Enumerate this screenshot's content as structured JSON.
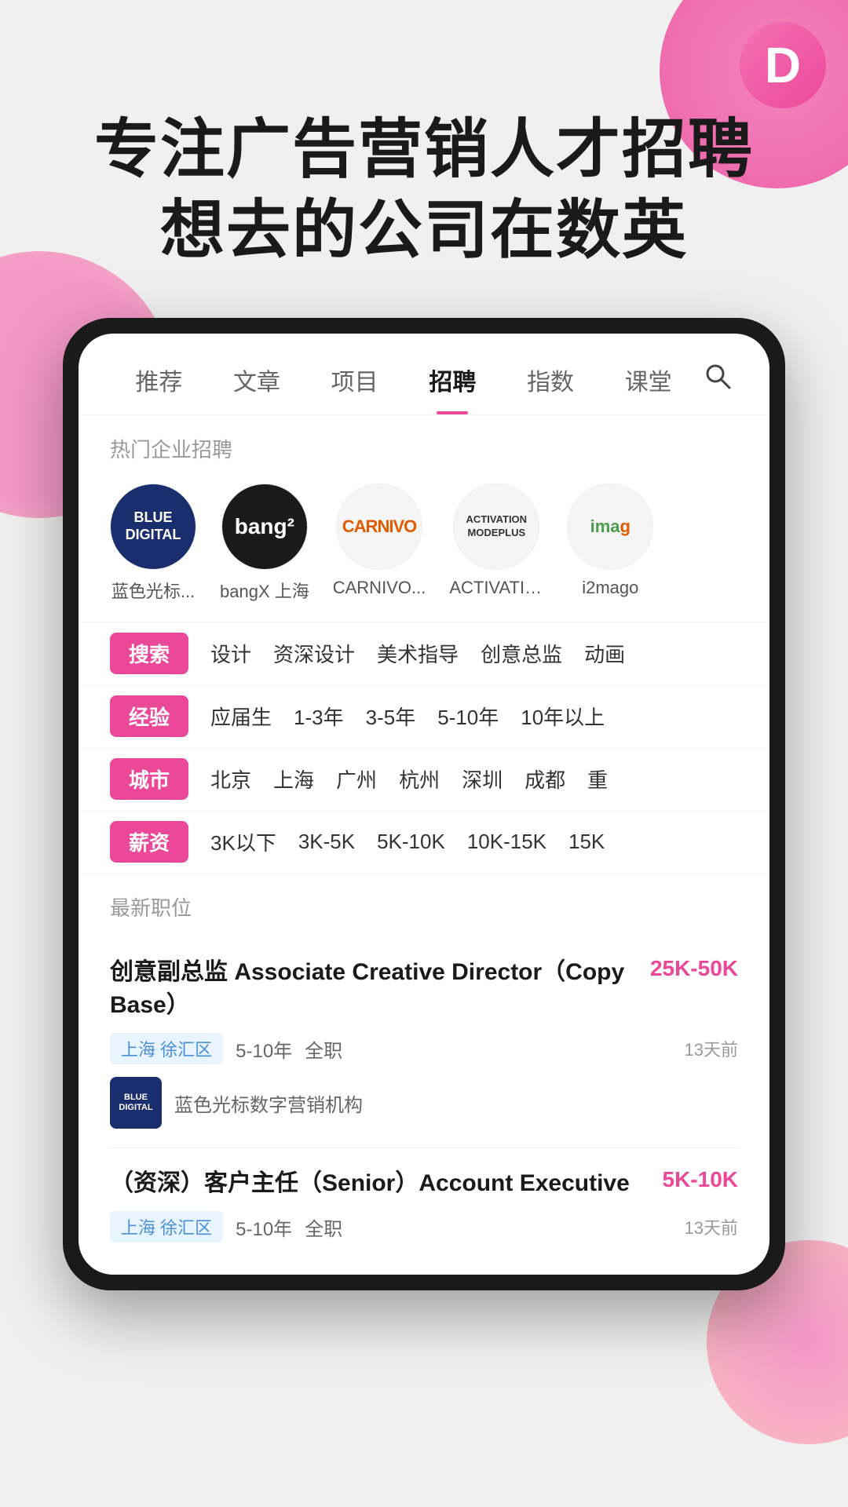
{
  "app": {
    "logo_letter": "D",
    "hero_line1": "专注广告营销人才招聘",
    "hero_line2": "想去的公司在数英"
  },
  "navbar": {
    "items": [
      {
        "label": "推荐",
        "active": false
      },
      {
        "label": "文章",
        "active": false
      },
      {
        "label": "项目",
        "active": false
      },
      {
        "label": "招聘",
        "active": true
      },
      {
        "label": "指数",
        "active": false
      },
      {
        "label": "课堂",
        "active": false
      }
    ],
    "search_icon": "search"
  },
  "hot_companies": {
    "label": "热门企业招聘",
    "items": [
      {
        "name": "蓝色光标...",
        "logo_type": "blue-digital",
        "logo_text": "BLUE\nDIGITAL"
      },
      {
        "name": "bangX 上海",
        "logo_type": "bangx",
        "logo_text": "bang²"
      },
      {
        "name": "CARNIVO...",
        "logo_type": "carnivo",
        "logo_text": "CARNIVO"
      },
      {
        "name": "ACTIVATIO...",
        "logo_type": "activation",
        "logo_text": "ACTIVATION\nMODEPLUS"
      },
      {
        "name": "i2mago",
        "logo_type": "i2mago",
        "logo_text": "ima"
      }
    ]
  },
  "filters": [
    {
      "badge": "搜索",
      "tags": [
        "设计",
        "资深设计",
        "美术指导",
        "创意总监",
        "动画"
      ]
    },
    {
      "badge": "经验",
      "tags": [
        "应届生",
        "1-3年",
        "3-5年",
        "5-10年",
        "10年以上"
      ]
    },
    {
      "badge": "城市",
      "tags": [
        "北京",
        "上海",
        "广州",
        "杭州",
        "深圳",
        "成都",
        "重"
      ]
    },
    {
      "badge": "薪资",
      "tags": [
        "3K以下",
        "3K-5K",
        "5K-10K",
        "10K-15K",
        "15K"
      ]
    }
  ],
  "latest_jobs": {
    "section_title": "最新职位",
    "jobs": [
      {
        "title": "创意副总监 Associate Creative Director（Copy Base）",
        "salary": "25K-50K",
        "location": "上海 徐汇区",
        "experience": "5-10年",
        "type": "全职",
        "time": "13天前",
        "company_name": "蓝色光标数字营销机构",
        "company_logo_type": "blue-digital"
      },
      {
        "title": "（资深）客户主任（Senior）Account Executive",
        "salary": "5K-10K",
        "location": "上海 徐汇区",
        "experience": "5-10年",
        "type": "全职",
        "time": "13天前",
        "company_name": "",
        "company_logo_type": ""
      }
    ]
  },
  "colors": {
    "accent": "#ec4899",
    "accent_light": "#fda4af",
    "blue_tag": "#4a90d9",
    "blue_tag_bg": "#e8f4ff"
  }
}
